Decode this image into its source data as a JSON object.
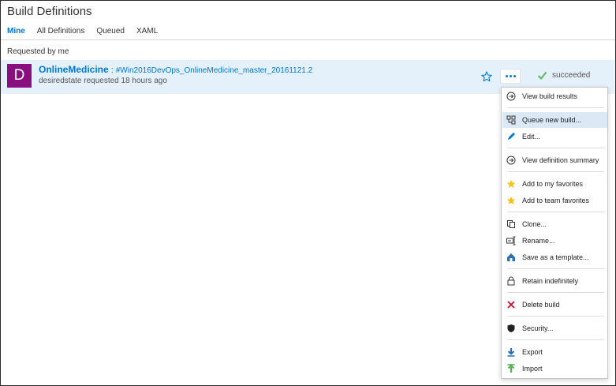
{
  "page": {
    "title": "Build Definitions"
  },
  "tabs": [
    {
      "label": "Mine",
      "active": true
    },
    {
      "label": "All Definitions",
      "active": false
    },
    {
      "label": "Queued",
      "active": false
    },
    {
      "label": "XAML",
      "active": false
    }
  ],
  "section": {
    "label": "Requested by me"
  },
  "build": {
    "avatar_letter": "D",
    "avatar_color": "#8a0f7e",
    "definition_name": "OnlineMedicine",
    "separator": ":",
    "build_number": "#Win2016DevOps_OnlineMedicine_master_20161121.2",
    "requested_text": "desiredstate requested 18 hours ago",
    "status": "succeeded",
    "status_color": "#5cb85c"
  },
  "colors": {
    "accent": "#0078d7",
    "row_highlight": "#e5f1fa"
  },
  "context_menu": {
    "items": [
      {
        "label": "View build results",
        "icon": "arrow-circle-icon"
      },
      {
        "label": "Queue new build...",
        "icon": "queue-build-icon",
        "highlighted": true
      },
      {
        "label": "Edit...",
        "icon": "pencil-icon"
      },
      {
        "label": "View definition summary",
        "icon": "arrow-circle-icon"
      },
      {
        "label": "Add to my favorites",
        "icon": "star-icon"
      },
      {
        "label": "Add to team favorites",
        "icon": "star-icon"
      },
      {
        "label": "Clone...",
        "icon": "copy-icon"
      },
      {
        "label": "Rename...",
        "icon": "rename-icon"
      },
      {
        "label": "Save as a template...",
        "icon": "template-icon"
      },
      {
        "label": "Retain indefinitely",
        "icon": "lock-icon"
      },
      {
        "label": "Delete build",
        "icon": "delete-x-icon"
      },
      {
        "label": "Security...",
        "icon": "shield-icon"
      },
      {
        "label": "Export",
        "icon": "export-arrow-icon"
      },
      {
        "label": "Import",
        "icon": "import-arrow-icon"
      }
    ]
  }
}
